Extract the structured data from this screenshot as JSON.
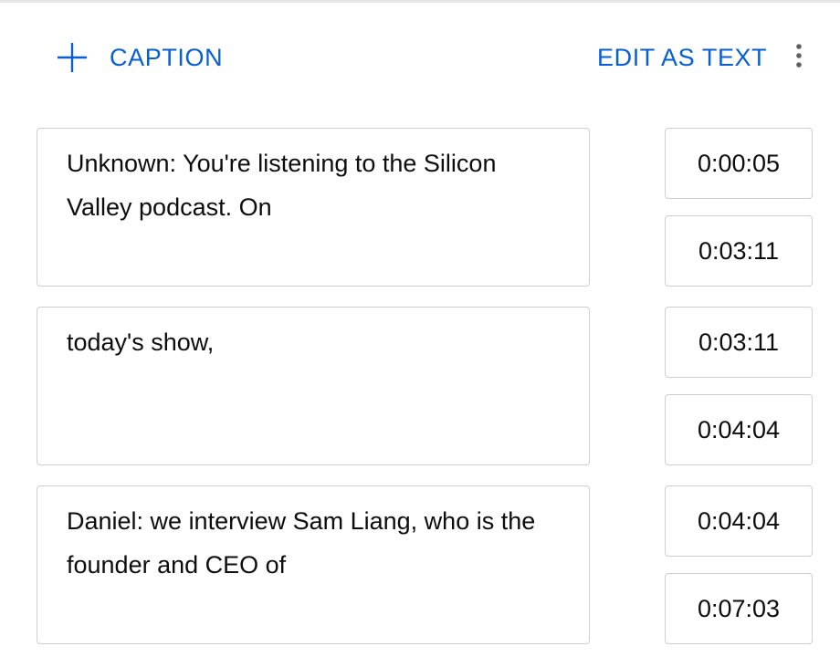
{
  "toolbar": {
    "add_caption_label": "CAPTION",
    "edit_as_text_label": "EDIT AS TEXT",
    "accent_color": "#065fd4"
  },
  "captions": [
    {
      "text": "Unknown: You're listening to the Silicon Valley podcast. On",
      "start": "0:00:05",
      "end": "0:03:11"
    },
    {
      "text": "today's show,",
      "start": "0:03:11",
      "end": "0:04:04"
    },
    {
      "text": "Daniel: we interview Sam Liang, who is the founder and CEO of",
      "start": "0:04:04",
      "end": "0:07:03"
    }
  ]
}
